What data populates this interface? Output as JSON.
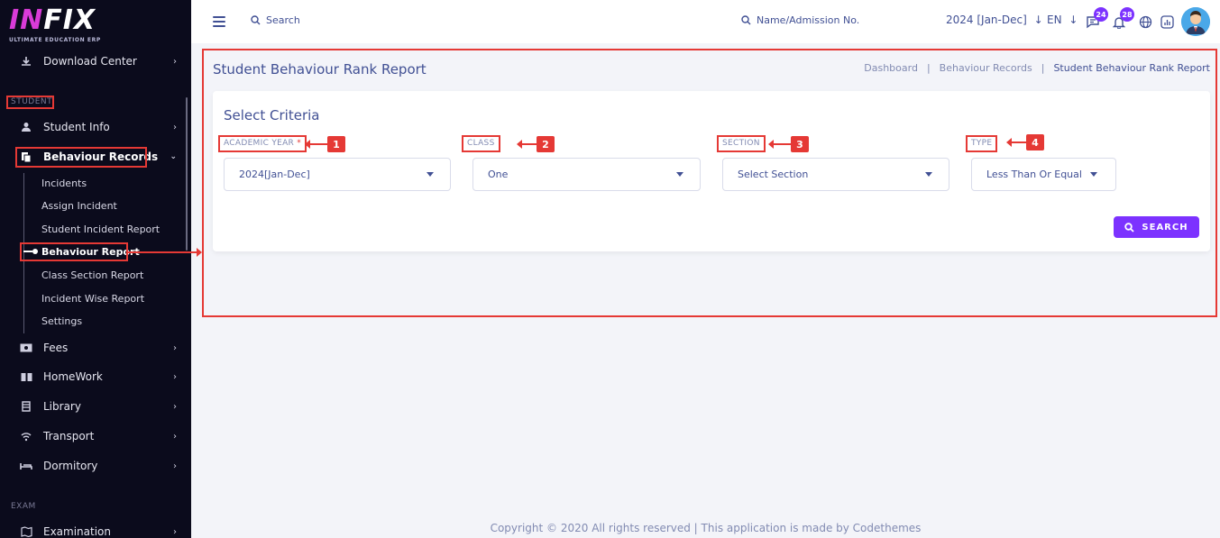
{
  "logo": {
    "name_a": "I",
    "name_b": "N",
    "name_c": "FIX",
    "tagline": "ULTIMATE EDUCATION ERP"
  },
  "sidebar": {
    "items": [
      {
        "label": "Download Center",
        "icon": "download-icon"
      },
      {
        "label": "Student Info",
        "icon": "user-icon"
      },
      {
        "label": "Behaviour Records",
        "icon": "file-copy-icon"
      },
      {
        "label": "Fees",
        "icon": "money-icon"
      },
      {
        "label": "HomeWork",
        "icon": "book-icon"
      },
      {
        "label": "Library",
        "icon": "library-icon"
      },
      {
        "label": "Transport",
        "icon": "wifi-icon"
      },
      {
        "label": "Dormitory",
        "icon": "bed-icon"
      },
      {
        "label": "Examination",
        "icon": "map-icon"
      }
    ],
    "sections": {
      "student": "STUDENT",
      "exam": "EXAM"
    },
    "sub_items": [
      "Incidents",
      "Assign Incident",
      "Student Incident Report",
      "Behaviour Report",
      "Class Section Report",
      "Incident Wise Report",
      "Settings"
    ]
  },
  "header": {
    "search": "Search",
    "name_search": "Name/Admission No.",
    "year": "2024 [Jan-Dec]",
    "language": "EN",
    "messages_count": "24",
    "notifications_count": "28"
  },
  "page": {
    "title": "Student Behaviour Rank Report",
    "breadcrumb": [
      "Dashboard",
      "Behaviour Records",
      "Student Behaviour Rank Report"
    ]
  },
  "criteria": {
    "title": "Select Criteria",
    "fields": [
      {
        "label": "ACADEMIC YEAR",
        "required": "*",
        "value": "2024[Jan-Dec]",
        "callout": "1"
      },
      {
        "label": "CLASS",
        "value": "One",
        "callout": "2"
      },
      {
        "label": "SECTION",
        "value": "Select Section",
        "callout": "3"
      },
      {
        "label": "TYPE",
        "value": "Less Than Or Equal",
        "callout": "4"
      }
    ],
    "search_button": "SEARCH"
  },
  "footer": {
    "text": "Copyright © 2020 All rights reserved | This application is made by Codethemes"
  },
  "colors": {
    "accent": "#7c32ff",
    "highlight": "#e53935",
    "sidebar": "#0b0b1c",
    "text": "#415094"
  }
}
